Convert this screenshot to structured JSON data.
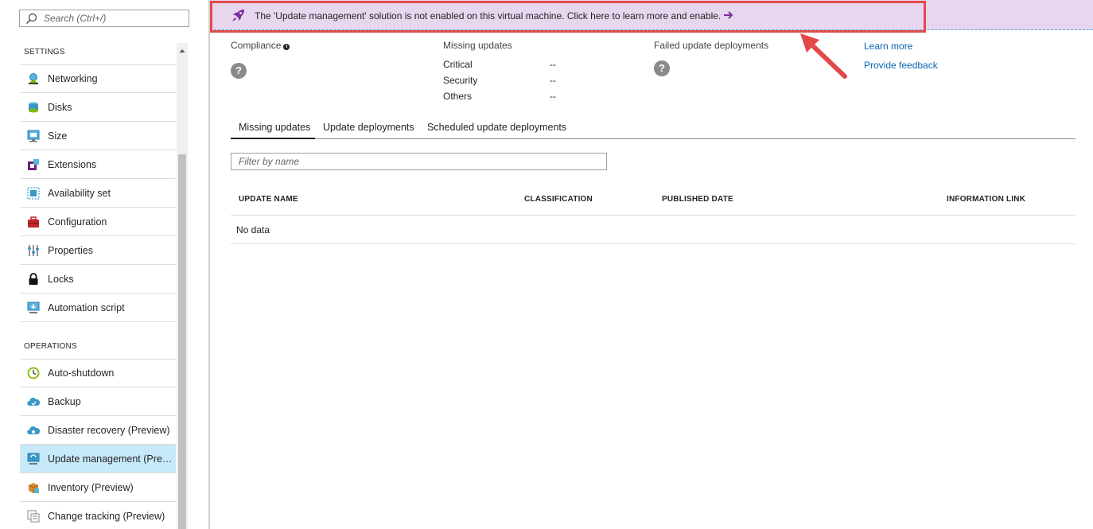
{
  "search": {
    "placeholder": "Search (Ctrl+/)"
  },
  "sidebar": {
    "settings_header": "SETTINGS",
    "settings_items": [
      {
        "label": "Networking",
        "icon": "networking-icon"
      },
      {
        "label": "Disks",
        "icon": "disks-icon"
      },
      {
        "label": "Size",
        "icon": "size-icon"
      },
      {
        "label": "Extensions",
        "icon": "extensions-icon"
      },
      {
        "label": "Availability set",
        "icon": "availability-set-icon"
      },
      {
        "label": "Configuration",
        "icon": "configuration-icon"
      },
      {
        "label": "Properties",
        "icon": "properties-icon"
      },
      {
        "label": "Locks",
        "icon": "lock-icon"
      },
      {
        "label": "Automation script",
        "icon": "automation-script-icon"
      }
    ],
    "operations_header": "OPERATIONS",
    "operations_items": [
      {
        "label": "Auto-shutdown",
        "icon": "clock-icon"
      },
      {
        "label": "Backup",
        "icon": "backup-cloud-icon"
      },
      {
        "label": "Disaster recovery (Preview)",
        "icon": "disaster-recovery-icon"
      },
      {
        "label": "Update management (Preview)",
        "icon": "update-management-icon",
        "active": true
      },
      {
        "label": "Inventory (Preview)",
        "icon": "inventory-icon"
      },
      {
        "label": "Change tracking (Preview)",
        "icon": "change-tracking-icon"
      }
    ]
  },
  "banner": {
    "text": "The 'Update management' solution is not enabled on this virtual machine. Click here to learn more and enable.",
    "icon": "rocket-icon",
    "arrow_icon": "arrow-right-icon",
    "highlight_color": "#e24a4a",
    "background": "#e6d6ee"
  },
  "summary": {
    "compliance_label": "Compliance",
    "missing_updates_label": "Missing updates",
    "missing_updates": [
      {
        "key": "Critical",
        "value": "--"
      },
      {
        "key": "Security",
        "value": "--"
      },
      {
        "key": "Others",
        "value": "--"
      }
    ],
    "failed_label": "Failed update deployments",
    "links": {
      "learn_more": "Learn more",
      "feedback": "Provide feedback"
    }
  },
  "tabs": [
    {
      "label": "Missing updates",
      "active": true
    },
    {
      "label": "Update deployments"
    },
    {
      "label": "Scheduled update deployments"
    }
  ],
  "filter": {
    "placeholder": "Filter by name"
  },
  "table": {
    "columns": [
      "UPDATE NAME",
      "CLASSIFICATION",
      "PUBLISHED DATE",
      "INFORMATION LINK"
    ],
    "empty_text": "No data"
  },
  "colors": {
    "accent_link": "#0a64b4",
    "active_nav": "#c7e9f9",
    "banner_purple": "#7b2ea3"
  }
}
